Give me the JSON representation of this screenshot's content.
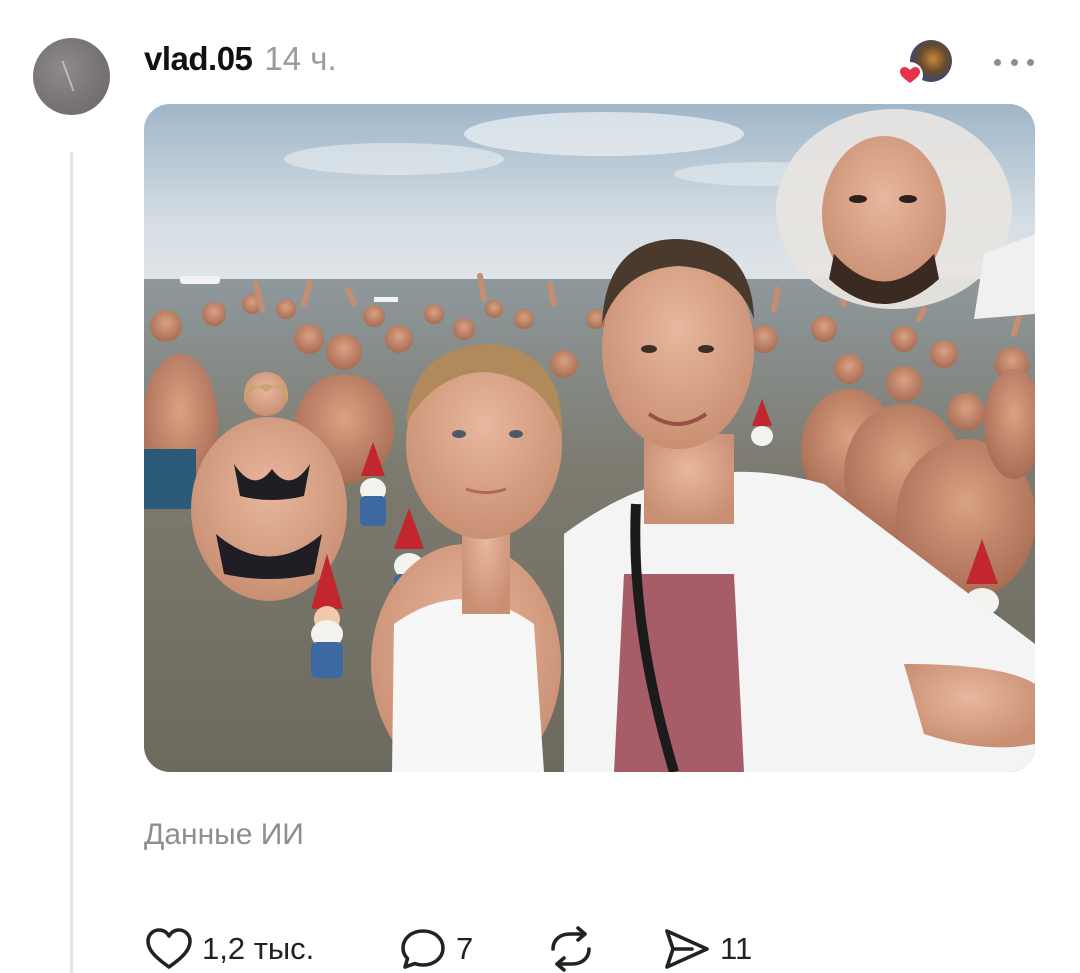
{
  "post": {
    "username": "vlad.05",
    "time": "14 ч.",
    "caption": "Данные ИИ",
    "image_alt": "AI-generated beach selfie of a young couple standing in the sea, surrounded by a crowd of shirtless men and garden gnomes, with a man's face in the sky",
    "liker_icon": "heart-icon"
  },
  "actions": {
    "likes": "1,2 тыс.",
    "comments": "7",
    "reposts": "",
    "shares": "11"
  },
  "colors": {
    "username": "#111111",
    "meta": "#9b9b9b",
    "heart": "#e8314a",
    "thread_line": "#e4e4e4"
  }
}
